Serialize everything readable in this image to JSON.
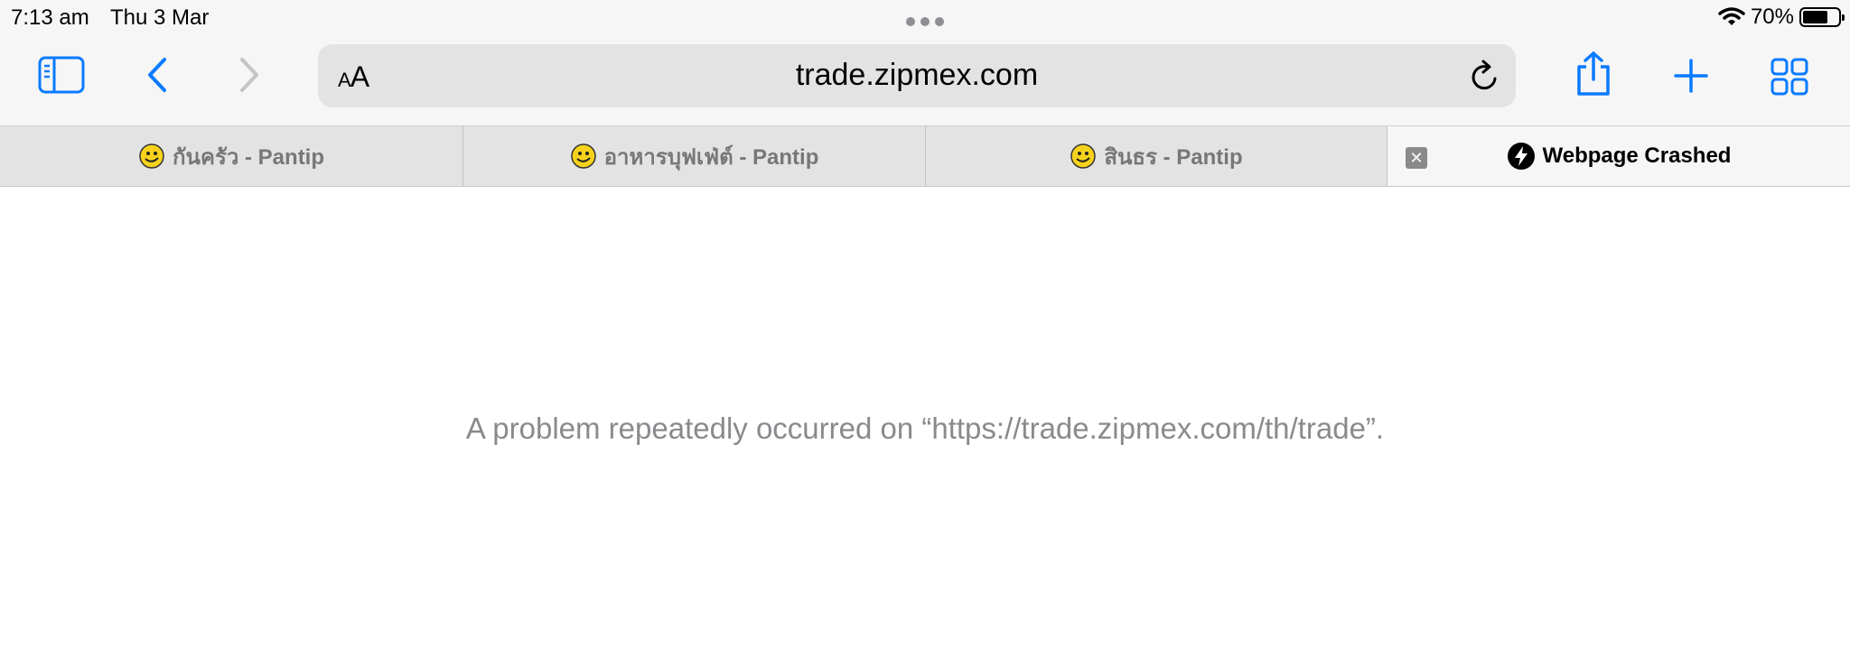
{
  "status_bar": {
    "time": "7:13 am",
    "date": "Thu 3 Mar",
    "battery_percent": "70%",
    "battery_level": 0.7,
    "wifi_icon": "wifi-icon"
  },
  "toolbar": {
    "sidebar_icon": "sidebar-icon",
    "back_icon": "chevron-left-icon",
    "forward_icon": "chevron-right-icon",
    "reader_label": "AA",
    "url": "trade.zipmex.com",
    "reload_icon": "reload-icon",
    "share_icon": "share-icon",
    "new_tab_icon": "plus-icon",
    "tab_overview_icon": "grid-icon",
    "accent_color": "#0a7aff",
    "disabled_color": "#c4c4c6"
  },
  "tabs": [
    {
      "title": "กันครัว - Pantip",
      "favicon": "pantip-face-icon",
      "active": false
    },
    {
      "title": "อาหารบุฟเฟ่ต์ - Pantip",
      "favicon": "pantip-face-icon",
      "active": false
    },
    {
      "title": "สินธร - Pantip",
      "favicon": "pantip-face-icon",
      "active": false
    },
    {
      "title": "Webpage Crashed",
      "favicon": "lightning-icon",
      "active": true,
      "close_icon": "close-icon"
    }
  ],
  "content": {
    "message": "A problem repeatedly occurred on “https://trade.zipmex.com/th/trade”."
  }
}
